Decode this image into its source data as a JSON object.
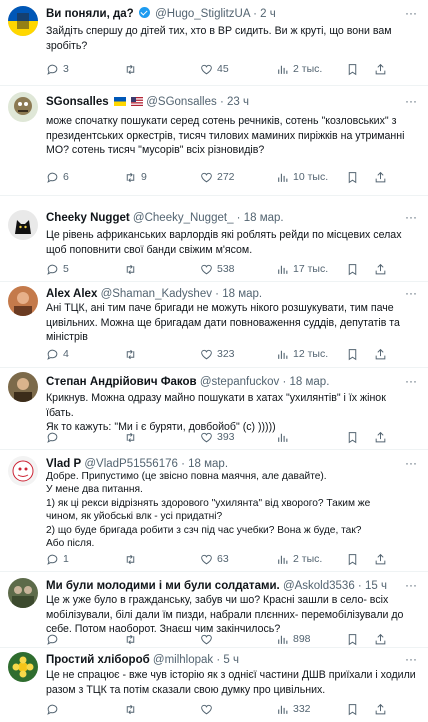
{
  "colors": {
    "accent": "#1d9bf0",
    "muted": "#536471",
    "text": "#0f1419"
  },
  "tweets": [
    {
      "name": "Ви поняли, да?",
      "handle": "@Hugo_StiglitzUA",
      "time": "2 ч",
      "lines": [
        "Зайдіть спершу до дітей тих, хто в ВР сидить. Ви ж круті, що вони вам",
        "зробіть?"
      ],
      "replies": "3",
      "retweets": "",
      "likes": "45",
      "views": "2 тыс.",
      "avatar_icon": "flag-avatar"
    },
    {
      "name": "SGonsalles",
      "handle": "@SGonsalles",
      "time": "23 ч",
      "lines": [
        "може спочатку пошукати серед сотень речників, сотень \"козловських\" з",
        "президентських оркестрів, тисяч тилових маминих пиріжків на утриманні",
        "МО?  сотень тисяч \"мусорів\" всіх різновидів?"
      ],
      "replies": "6",
      "retweets": "9",
      "likes": "272",
      "views": "10 тыс.",
      "avatar_icon": "cartoon-avatar"
    },
    {
      "name": "Cheeky Nugget",
      "handle": "@Cheeky_Nugget_",
      "time": "18 мар.",
      "lines": [
        "Це рівень африканських варлордів які роблять рейди по місцевих селах",
        "щоб поповнити свої банди свіжим м'ясом."
      ],
      "replies": "5",
      "retweets": "",
      "likes": "538",
      "views": "17 тыс.",
      "avatar_icon": "cat-avatar"
    },
    {
      "name": "Alex Alex",
      "handle": "@Shaman_Kadyshev",
      "time": "18 мар.",
      "lines": [
        "Ані ТЦК, ані тим паче бригади не можуть нікого розшукувати, тим паче",
        "цивільних. Можна ще бригадам дати повноваження суддів, депутатів та",
        "міністрів"
      ],
      "replies": "4",
      "retweets": "",
      "likes": "323",
      "views": "12 тыс.",
      "avatar_icon": "person-avatar"
    },
    {
      "name": "Степан Андрійович Факов",
      "handle": "@stepanfuckov",
      "time": "18 мар.",
      "lines": [
        "Крикнув. Можна одразу майно пошукати в хатах \"ухилянтів\" і їх жінок їбать.",
        "Як то кажуть: \"Ми і є буряти, довбойоб\" (с) )))))"
      ],
      "replies": "",
      "retweets": "",
      "likes": "393",
      "views": "",
      "avatar_icon": "person-avatar"
    },
    {
      "name": "Vlad P",
      "handle": "@VladP51556176",
      "time": "18 мар.",
      "lines": [
        "Добре. Припустимо (це звісно повна маячня, але давайте).",
        "У мене два питання.",
        "1) як ці рекси відрізнять здорового \"ухилянта\" від хворого? Таким же",
        "чином, як уйобські влк - усі придатні?",
        "2) що буде бригада робити з сзч під час учебки? Вона ж буде, так?",
        "Або після."
      ],
      "replies": "1",
      "retweets": "",
      "likes": "63",
      "views": "2 тыс.",
      "avatar_icon": "face-avatar"
    },
    {
      "name": "Ми були молодими і ми були солдатами.",
      "handle": "@Askold3536",
      "time": "15 ч",
      "lines": [
        "Це ж уже було в гражданську, забув чи шо? Красні зашли в село- всіх",
        "мобілізували, білі дали їм пизди, набрали плєнних- перемобілізували до",
        "себе.  Потом наоборот. Знаєш чим закінчилось?"
      ],
      "replies": "",
      "retweets": "",
      "likes": "",
      "views": "898",
      "avatar_icon": "group-avatar"
    },
    {
      "name": "Простий хлібороб",
      "handle": "@milhlopak",
      "time": "5 ч",
      "lines": [
        "Це не спрацює - вже чув історію як з однієї частини ДШВ приїхали і ходили",
        "разом з ТЦК та потім сказали свою думку про цивільних."
      ],
      "replies": "",
      "retweets": "",
      "likes": "",
      "views": "332",
      "avatar_icon": "flower-avatar"
    }
  ]
}
